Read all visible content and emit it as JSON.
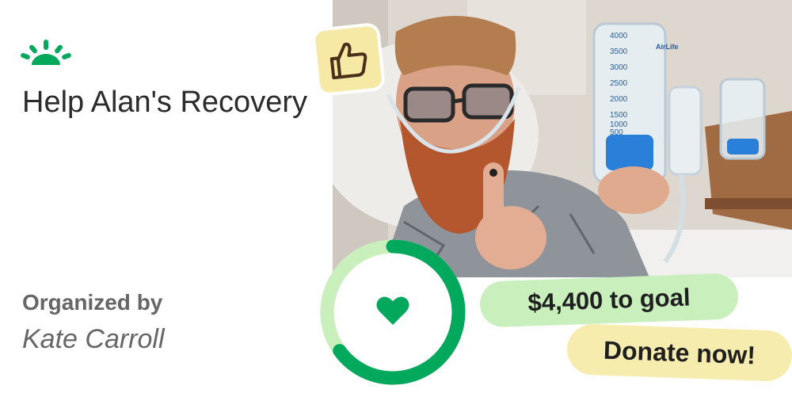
{
  "fundraiser": {
    "title": "Help Alan's Recovery",
    "organizer_label": "Organized by",
    "organizer_name": "Kate Carroll",
    "remaining_to_goal": "$4,400 to goal",
    "donate_label": "Donate now!",
    "progress_fraction": 0.65
  },
  "photo": {
    "spirometer_brand": "AirLife",
    "scale_labels": [
      "4000",
      "3500",
      "3000",
      "2500",
      "2000",
      "1500",
      "1000",
      "500"
    ]
  },
  "icons": {
    "logo": "sun-rays-icon",
    "badge": "thumbs-up-icon",
    "ring_center": "heart-icon"
  },
  "colors": {
    "brand_green": "#02a95c",
    "light_green": "#c9efbd",
    "yellow": "#f6ecae",
    "text_dark": "#2b2b2b",
    "text_gray": "#666666"
  }
}
